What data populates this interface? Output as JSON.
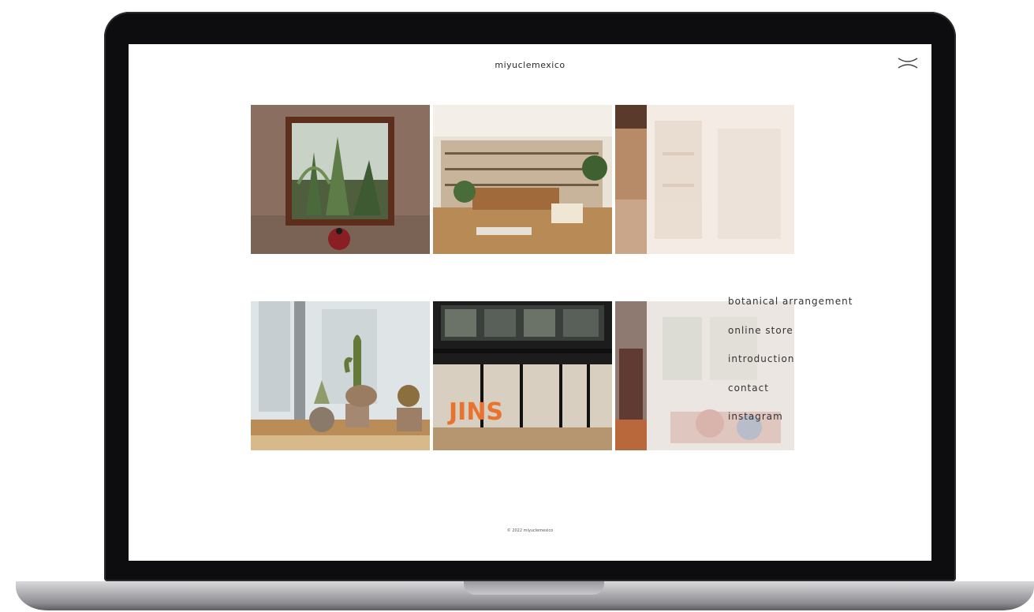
{
  "site": {
    "title": "miyuclemexico"
  },
  "header": {
    "close_icon": "close-icon"
  },
  "gallery": [
    {
      "name": "window-plants",
      "faded": false
    },
    {
      "name": "shop-interior",
      "faded": false
    },
    {
      "name": "store-shelves",
      "faded": true
    },
    {
      "name": "potted-cacti",
      "faded": false
    },
    {
      "name": "jins-storefront",
      "faded": false,
      "sign": "JINS"
    },
    {
      "name": "clothing-store",
      "faded": true
    }
  ],
  "menu": {
    "items": [
      {
        "label": "botanical arrangement"
      },
      {
        "label": "online store"
      },
      {
        "label": "introduction"
      },
      {
        "label": "contact"
      },
      {
        "label": "instagram"
      }
    ]
  },
  "footer": {
    "copyright": "© 2022 miyuclemexico"
  },
  "colors": {
    "bezel": "#0d0c0e",
    "screen": "#ffffff",
    "text": "#333333"
  }
}
